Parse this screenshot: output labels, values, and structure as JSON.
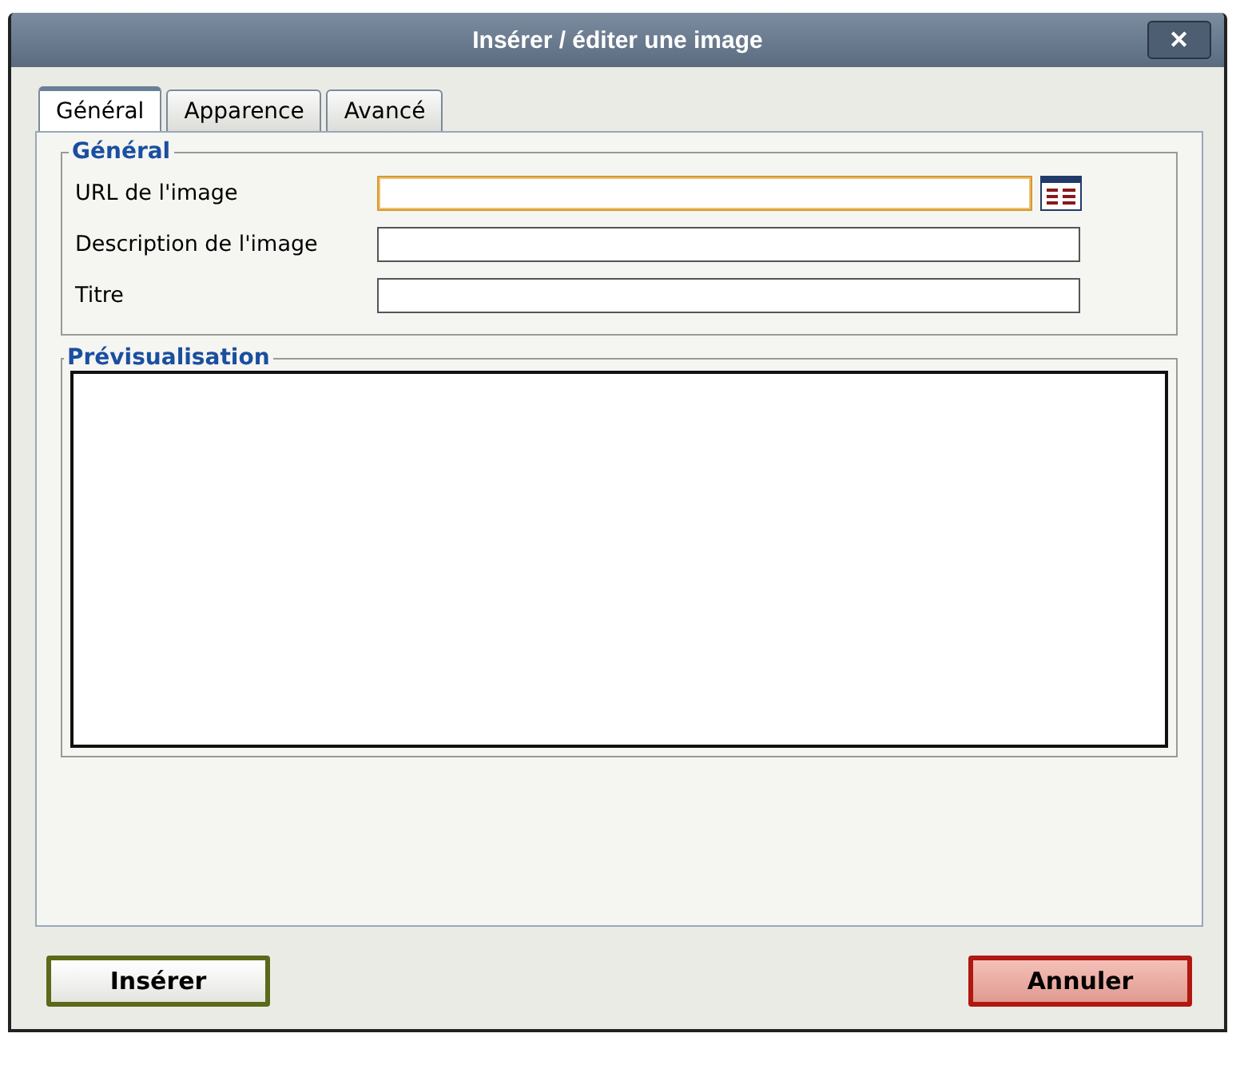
{
  "window": {
    "title": "Insérer / éditer une image",
    "close": "✕"
  },
  "tabs": [
    {
      "label": "Général",
      "selected": true
    },
    {
      "label": "Apparence",
      "selected": false
    },
    {
      "label": "Avancé",
      "selected": false
    }
  ],
  "general": {
    "legend": "Général",
    "fields": [
      {
        "label": "URL de l'image",
        "focused": true,
        "browse": true
      },
      {
        "label": "Description de l'image",
        "focused": false,
        "browse": false
      },
      {
        "label": "Titre",
        "focused": false,
        "browse": false
      }
    ]
  },
  "preview": {
    "legend": "Prévisualisation"
  },
  "buttons": [
    {
      "label": "Insérer",
      "kind": "primary"
    },
    {
      "label": "Annuler",
      "kind": "cancel"
    }
  ]
}
